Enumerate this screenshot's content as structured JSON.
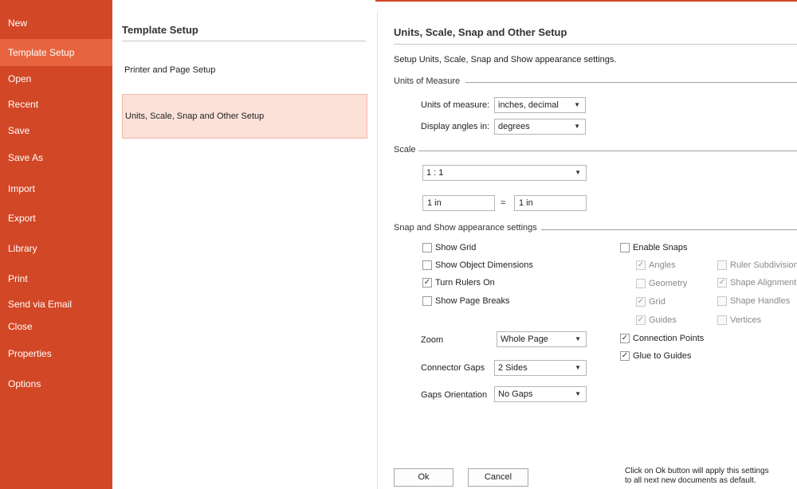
{
  "sidebar": {
    "items": [
      {
        "label": "New"
      },
      {
        "label": "Template Setup"
      },
      {
        "label": "Open"
      },
      {
        "label": "Recent"
      },
      {
        "label": "Save"
      },
      {
        "label": "Save As"
      },
      {
        "label": "Import"
      },
      {
        "label": "Export"
      },
      {
        "label": "Library"
      },
      {
        "label": "Print"
      },
      {
        "label": "Send via Email"
      },
      {
        "label": "Close"
      },
      {
        "label": "Properties"
      },
      {
        "label": "Options"
      }
    ],
    "active_index": 1,
    "color": "#d24726",
    "active_color": "#e8643e"
  },
  "middle": {
    "title": "Template Setup",
    "items": [
      {
        "label": "Printer and Page Setup"
      },
      {
        "label": "Units, Scale, Snap and Other Setup"
      }
    ],
    "selected_index": 1
  },
  "panel": {
    "title": "Units, Scale, Snap and Other Setup",
    "description": "Setup Units, Scale, Snap and Show appearance settings.",
    "units": {
      "section": "Units of Measure",
      "units_label": "Units of measure:",
      "units_value": "inches, decimal",
      "angles_label": "Display angles in:",
      "angles_value": "degrees"
    },
    "scale": {
      "section": "Scale",
      "ratio_value": "1 : 1",
      "left_value": "1 in",
      "equals": "=",
      "right_value": "1 in"
    },
    "snap": {
      "section": "Snap and Show appearance settings",
      "show_grid": "Show Grid",
      "show_object_dimensions": "Show Object Dimensions",
      "turn_rulers_on": "Turn Rulers On",
      "show_page_breaks": "Show Page Breaks",
      "enable_snaps": "Enable Snaps",
      "angles": "Angles",
      "geometry": "Geometry",
      "grid": "Grid",
      "guides": "Guides",
      "ruler_subdivisions": "Ruler Subdivisions",
      "shape_alignment": "Shape Alignment E",
      "shape_handles": "Shape Handles",
      "vertices": "Vertices",
      "connection_points": "Connection Points",
      "glue_to_guides": "Glue to Guides",
      "zoom_label": "Zoom",
      "zoom_value": "Whole Page",
      "connector_gaps_label": "Connector Gaps",
      "connector_gaps_value": "2 Sides",
      "gaps_orientation_label": "Gaps Orientation",
      "gaps_orientation_value": "No Gaps"
    },
    "checkbox_states": {
      "show_grid": false,
      "show_object_dimensions": false,
      "turn_rulers_on": true,
      "show_page_breaks": false,
      "enable_snaps": false,
      "angles": true,
      "geometry": false,
      "grid": true,
      "guides": true,
      "ruler_subdivisions": false,
      "shape_alignment": true,
      "shape_handles": false,
      "vertices": false,
      "connection_points": true,
      "glue_to_guides": true
    },
    "buttons": {
      "ok": "Ok",
      "cancel": "Cancel"
    },
    "note_line1": "Click on Ok button will apply this settings",
    "note_line2": "to all next new documents as default."
  },
  "icons": {
    "dropdown": "chevron-down-icon",
    "checkmark": "checkmark-icon"
  }
}
